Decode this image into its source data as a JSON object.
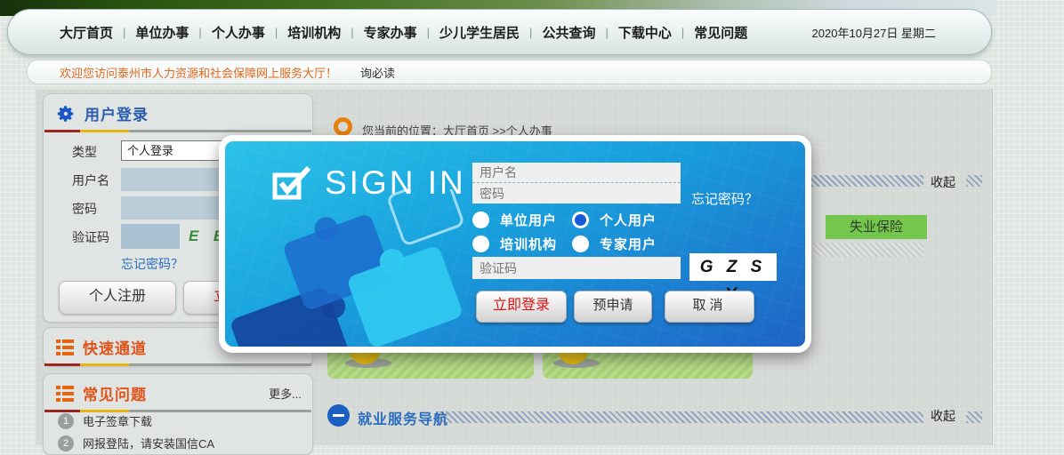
{
  "nav": {
    "items": [
      "大厅首页",
      "单位办事",
      "个人办事",
      "培训机构",
      "专家办事",
      "少儿学生居民",
      "公共查询",
      "下载中心",
      "常见问题"
    ],
    "separator": "|",
    "date": "2020年10月27日 星期二"
  },
  "welcome": {
    "text": "欢迎您访问泰州市人力资源和社会保障网上服务大厅！",
    "suffix": "询必读"
  },
  "sidebar": {
    "login": {
      "title": "用户登录",
      "type_label": "类型",
      "type_value": "个人登录",
      "username_label": "用户名",
      "password_label": "密码",
      "captcha_label": "验证码",
      "captcha_code": "E B",
      "forgot": "忘记密码？",
      "register_button": "个人注册",
      "login_button": "立即登录"
    },
    "quick": {
      "title": "快速通道"
    },
    "faq": {
      "title": "常见问题",
      "more": "更多...",
      "items": [
        {
          "num": "1",
          "text": "电子签章下载"
        },
        {
          "num": "2",
          "text": "网报登陆，请安装国信CA"
        }
      ]
    }
  },
  "main": {
    "breadcrumb": "您当前的位置：大厅首页 >>个人办事",
    "collapse_label": "收起",
    "unemployment_button": "失业保险",
    "employment_nav_title": "就业服务导航"
  },
  "modal": {
    "brand": "SIGN IN",
    "username_placeholder": "用户名",
    "password_placeholder": "密码",
    "forgot": "忘记密码？",
    "radios": [
      {
        "label": "单位用户",
        "checked": false
      },
      {
        "label": "个人用户",
        "checked": true
      },
      {
        "label": "培训机构",
        "checked": false
      },
      {
        "label": "专家用户",
        "checked": false
      }
    ],
    "captcha_placeholder": "验证码",
    "captcha_code": "G Z S Y",
    "buttons": {
      "login": "立即登录",
      "pre_apply": "预申请",
      "cancel": "取消"
    }
  },
  "colors": {
    "modal_gradient_top": "#2cc2e8",
    "modal_gradient_bottom": "#1e63c6",
    "accent_orange": "#e0541a",
    "accent_blue": "#2a6cc0",
    "green_button": "#74c74c",
    "captcha_green": "#3a8a3a",
    "underline_red": "#9c271f",
    "underline_yellow": "#e7b512"
  }
}
